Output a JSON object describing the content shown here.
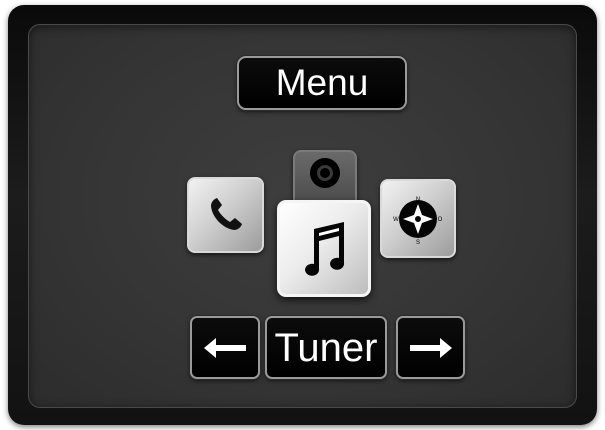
{
  "header": {
    "title": "Menu"
  },
  "menu_items": [
    {
      "name": "Phone",
      "icon": "phone-icon",
      "selected": false
    },
    {
      "name": "Disc",
      "icon": "disc-icon",
      "selected": false
    },
    {
      "name": "Music",
      "icon": "music-note-icon",
      "selected": true
    },
    {
      "name": "Navigation",
      "icon": "compass-icon",
      "selected": false
    }
  ],
  "footer": {
    "left_icon": "arrow-left-icon",
    "label": "Tuner",
    "right_icon": "arrow-right-icon"
  },
  "colors": {
    "bezel": "#121212",
    "screen": "#353535",
    "button_bg": "#000000",
    "button_border": "#9a9a9a",
    "text": "#ffffff"
  }
}
